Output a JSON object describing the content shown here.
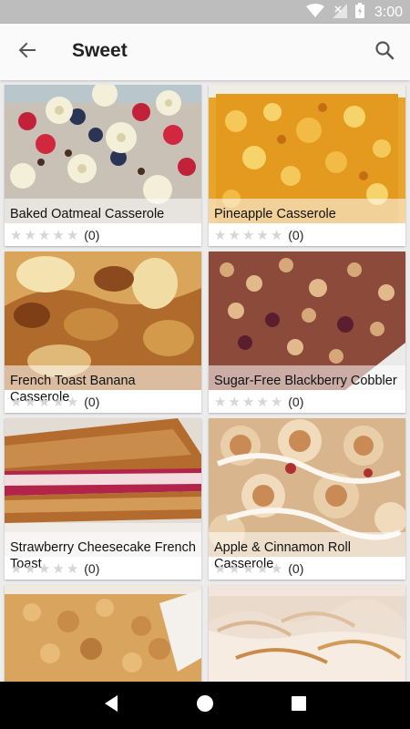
{
  "status_bar": {
    "time": "3:00"
  },
  "app_bar": {
    "title": "Sweet"
  },
  "recipes": [
    {
      "title": "Baked Oatmeal Casserole",
      "rating_count": "(0)",
      "stars": 0
    },
    {
      "title": "Pineapple Casserole",
      "rating_count": "(0)",
      "stars": 0
    },
    {
      "title": "French Toast Banana Casserole",
      "rating_count": "(0)",
      "stars": 0
    },
    {
      "title": "Sugar-Free Blackberry Cobbler",
      "rating_count": "(0)",
      "stars": 0
    },
    {
      "title": "Strawberry Cheesecake French Toast",
      "rating_count": "(0)",
      "stars": 0
    },
    {
      "title": "Apple & Cinnamon Roll Casserole",
      "rating_count": "(0)",
      "stars": 0
    },
    {
      "title": "",
      "rating_count": "",
      "stars": 0
    },
    {
      "title": "",
      "rating_count": "",
      "stars": 0
    }
  ],
  "icons": {
    "wifi": "wifi-icon",
    "signal": "signal-icon",
    "battery": "battery-icon",
    "back": "arrow-back-icon",
    "search": "search-icon",
    "nav_back": "nav-back-icon",
    "nav_home": "nav-home-icon",
    "nav_recents": "nav-recents-icon"
  },
  "colors": {
    "status_bar": "#bdbdbd",
    "app_bar": "#fafafa",
    "background": "#ececec",
    "star_empty": "#d6d6d6",
    "nav_bar": "#000000"
  }
}
